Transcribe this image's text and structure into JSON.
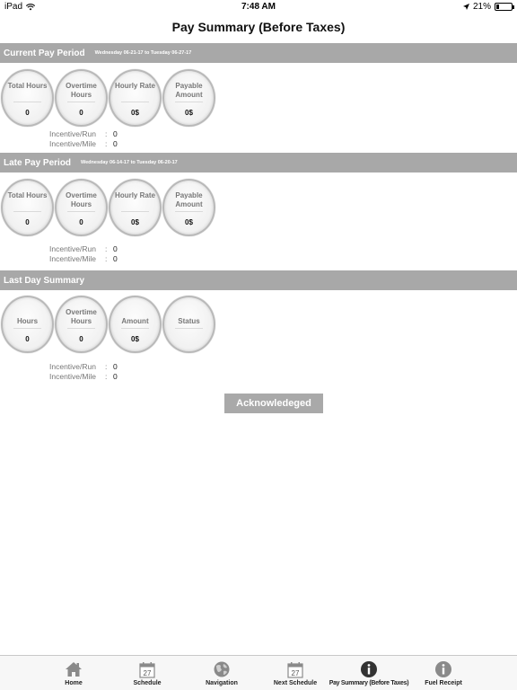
{
  "status_bar": {
    "device": "iPad",
    "time": "7:48 AM",
    "battery": "21%",
    "battery_fraction": 0.21
  },
  "nav": {
    "title": "Pay Summary (Before Taxes)"
  },
  "current_period": {
    "title": "Current Pay Period",
    "range": "Wednesday 06-21-17 to Tuesday 06-27-17",
    "circles": [
      {
        "label": "Total Hours",
        "value": "0"
      },
      {
        "label": "Overtime Hours",
        "value": "0"
      },
      {
        "label": "Hourly Rate",
        "value": "0$"
      },
      {
        "label": "Payable Amount",
        "value": "0$"
      }
    ],
    "incentive_run_label": "Incentive/Run",
    "incentive_run_value": "0",
    "incentive_mile_label": "Incentive/Mile",
    "incentive_mile_value": "0"
  },
  "late_period": {
    "title": "Late Pay Period",
    "range": "Wednesday 06-14-17 to Tuesday 06-20-17",
    "circles": [
      {
        "label": "Total Hours",
        "value": "0"
      },
      {
        "label": "Overtime Hours",
        "value": "0"
      },
      {
        "label": "Hourly Rate",
        "value": "0$"
      },
      {
        "label": "Payable Amount",
        "value": "0$"
      }
    ],
    "incentive_run_label": "Incentive/Run",
    "incentive_run_value": "0",
    "incentive_mile_label": "Incentive/Mile",
    "incentive_mile_value": "0"
  },
  "last_day": {
    "title": "Last Day Summary",
    "circles": [
      {
        "label": "Hours",
        "value": "0"
      },
      {
        "label": "Overtime Hours",
        "value": "0"
      },
      {
        "label": "Amount",
        "value": "0$"
      },
      {
        "label": "Status",
        "value": ""
      }
    ],
    "incentive_run_label": "Incentive/Run",
    "incentive_run_value": "0",
    "incentive_mile_label": "Incentive/Mile",
    "incentive_mile_value": "0"
  },
  "acknowledge_label": "Acknowledeged",
  "tabs": [
    {
      "label": "Home",
      "icon": "home-icon"
    },
    {
      "label": "Schedule",
      "icon": "calendar-icon",
      "day": "27"
    },
    {
      "label": "Navigation",
      "icon": "globe-icon"
    },
    {
      "label": "Next Schedule",
      "icon": "calendar-icon",
      "day": "27"
    },
    {
      "label": "Pay Summary (Before Taxes)",
      "icon": "info-icon"
    },
    {
      "label": "Fuel Receipt",
      "icon": "info-icon"
    }
  ],
  "colors": {
    "section_header": "#a8a8a8",
    "button": "#a9a9a9",
    "tab_active": "#333333",
    "tab_inactive": "#8a8a8a"
  }
}
